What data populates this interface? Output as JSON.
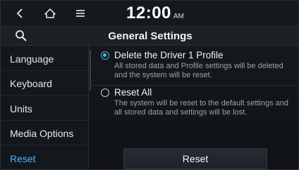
{
  "status_bar": {
    "time": "12:00",
    "ampm": "AM"
  },
  "header": {
    "title": "General Settings"
  },
  "sidebar": {
    "items": [
      {
        "label": "Language"
      },
      {
        "label": "Keyboard"
      },
      {
        "label": "Units"
      },
      {
        "label": "Media Options"
      },
      {
        "label": "Reset",
        "active": true
      }
    ]
  },
  "main": {
    "options": [
      {
        "label": "Delete the Driver 1 Profile",
        "description": "All stored data and Profile settings will be deleted and the system will be reset.",
        "selected": true
      },
      {
        "label": "Reset All",
        "description": "The system will be reset to the default settings and all stored data and settings will be lost.",
        "selected": false
      }
    ],
    "reset_button": "Reset"
  },
  "colors": {
    "accent": "#4ab3ff",
    "background": "#14181c",
    "text": "#e6e9ec",
    "muted_text": "#9aa2ab"
  },
  "icons": [
    "back-icon",
    "home-icon",
    "menu-icon",
    "search-icon"
  ]
}
